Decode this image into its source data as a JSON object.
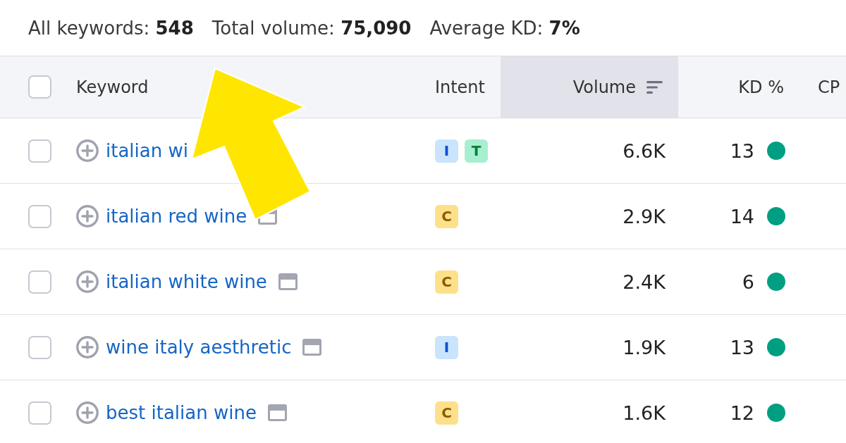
{
  "summary": [
    "All keywords: **548**",
    "Total volume: **75,090**",
    "Average KD: **7%**"
  ],
  "table": {
    "header_checkbox": {
      "checked": false
    },
    "columns": [
      {
        "label": "Keyword",
        "sorted": false
      },
      {
        "label": "Intent",
        "sorted": false
      },
      {
        "label": "Volume",
        "sorted": true
      },
      {
        "label": "KD %",
        "sorted": false
      },
      {
        "label": "CP",
        "sorted": false
      }
    ],
    "rows": [
      {
        "checked": false,
        "keyword": "italian wi",
        "serp_icon": false,
        "intent": [
          {
            "label": "I",
            "color": "#c9e4fc"
          },
          {
            "label": "T",
            "color": "#a7efd0"
          }
        ],
        "volume": "6.6K",
        "kd": {
          "value": "13",
          "color": "#009f81"
        }
      },
      {
        "checked": false,
        "keyword": "italian red wine",
        "serp_icon": true,
        "intent": [
          {
            "label": "C",
            "color": "#fde08a"
          }
        ],
        "volume": "2.9K",
        "kd": {
          "value": "14",
          "color": "#009f81"
        }
      },
      {
        "checked": false,
        "keyword": "italian white wine",
        "serp_icon": true,
        "intent": [
          {
            "label": "C",
            "color": "#fde08a"
          }
        ],
        "volume": "2.4K",
        "kd": {
          "value": "6",
          "color": "#009f81"
        }
      },
      {
        "checked": false,
        "keyword": "wine italy aesthretic",
        "serp_icon": true,
        "intent": [
          {
            "label": "I",
            "color": "#c9e4fc"
          }
        ],
        "volume": "1.9K",
        "kd": {
          "value": "13",
          "color": "#009f81"
        }
      },
      {
        "checked": false,
        "keyword": "best italian wine",
        "serp_icon": true,
        "intent": [
          {
            "label": "C",
            "color": "#fde08a"
          }
        ],
        "volume": "1.6K",
        "kd": {
          "value": "12",
          "color": "#009f81"
        }
      }
    ]
  },
  "annotations": [
    {
      "kind": "arrow"
    }
  ]
}
